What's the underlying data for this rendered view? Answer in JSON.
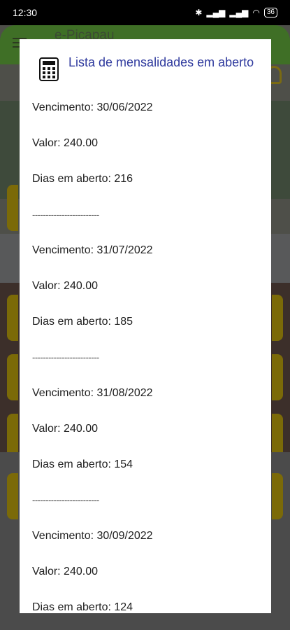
{
  "status_bar": {
    "time": "12:30",
    "battery": "36"
  },
  "app": {
    "title": "e-Picapau"
  },
  "dialog": {
    "title": "Lista de mensalidades em aberto",
    "lines": [
      "Vencimento: 30/06/2022",
      "Valor: 240.00",
      "Dias em aberto: 216",
      "-------------------------",
      "Vencimento: 31/07/2022",
      "Valor: 240.00",
      "Dias em aberto: 185",
      "-------------------------",
      "Vencimento: 31/08/2022",
      "Valor: 240.00",
      "Dias em aberto: 154",
      "-------------------------",
      "Vencimento: 30/09/2022",
      "Valor: 240.00",
      "Dias em aberto: 124"
    ]
  },
  "colors": {
    "title": "#2f3a9e",
    "appbar": "#3f6f26"
  },
  "icons": {
    "dialog": "calculator-icon"
  }
}
